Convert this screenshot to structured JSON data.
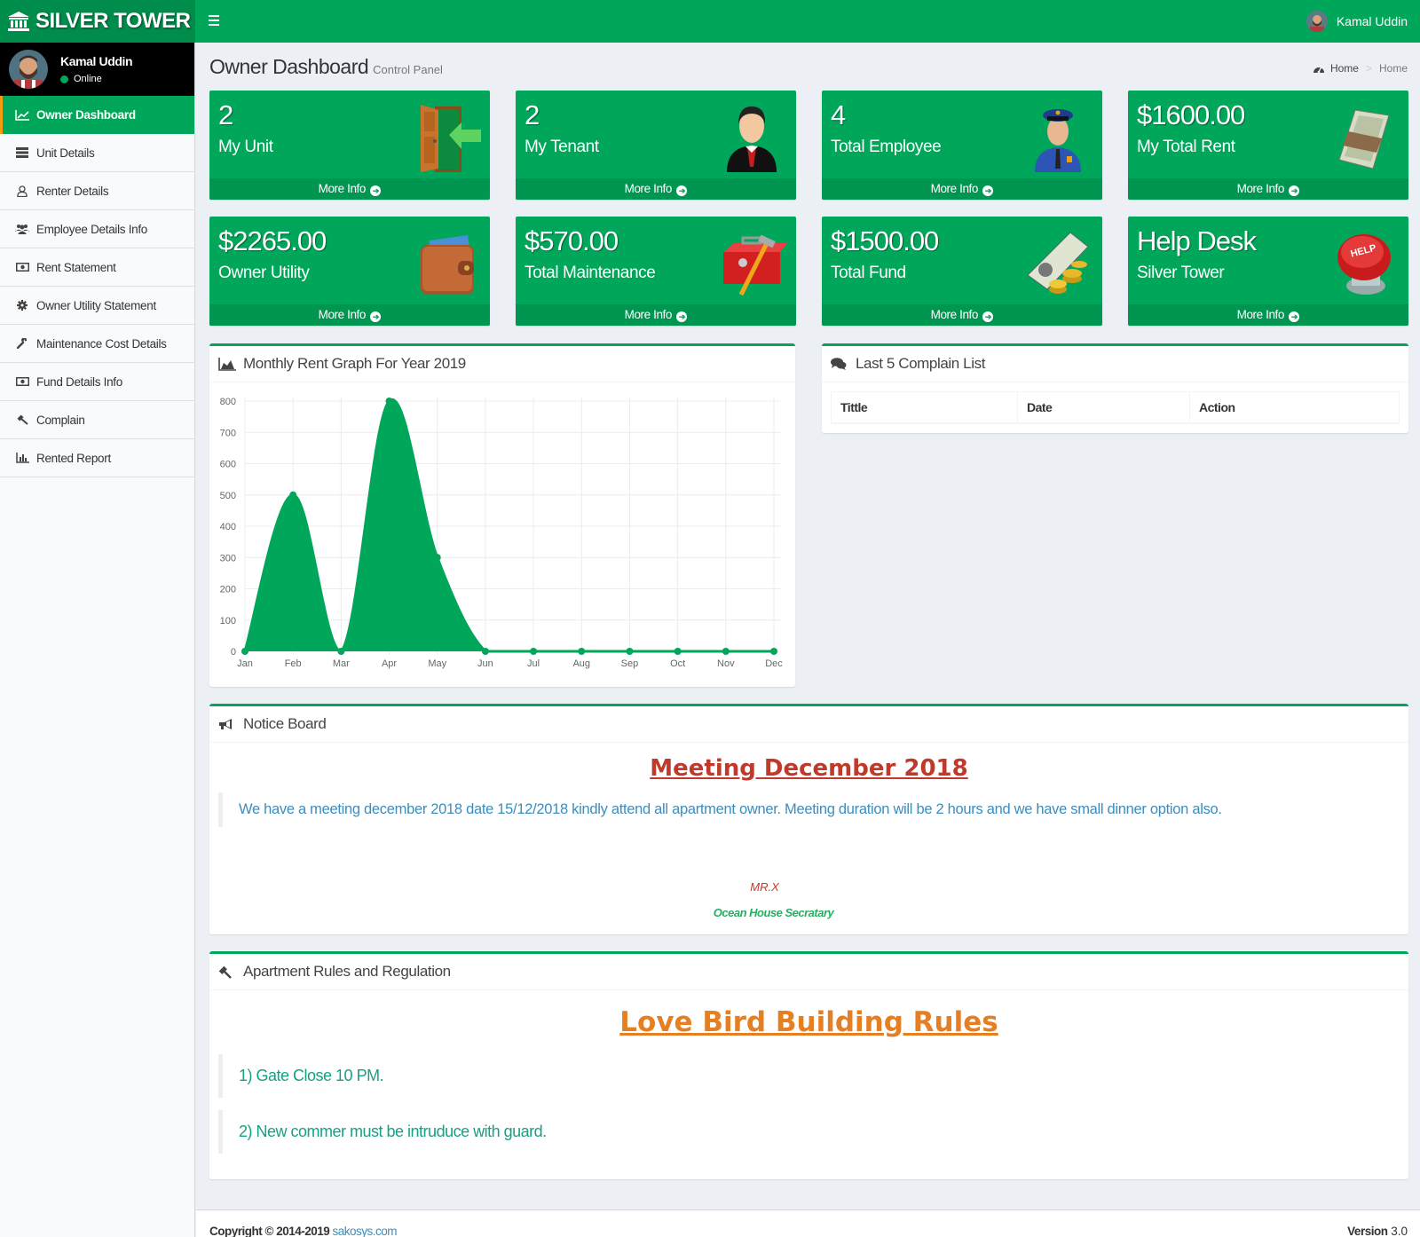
{
  "app": {
    "logo_text": "SILVER TOWER"
  },
  "topbar": {
    "user_name": "Kamal Uddin"
  },
  "user_panel": {
    "name": "Kamal Uddin",
    "status": "Online"
  },
  "sidebar": {
    "items": [
      {
        "label": "Owner Dashboard",
        "icon": "line-chart-icon",
        "active": true
      },
      {
        "label": "Unit Details",
        "icon": "list-icon"
      },
      {
        "label": "Renter Details",
        "icon": "user-icon"
      },
      {
        "label": "Employee Details Info",
        "icon": "users-icon"
      },
      {
        "label": "Rent Statement",
        "icon": "money-icon"
      },
      {
        "label": "Owner Utility Statement",
        "icon": "gear-icon"
      },
      {
        "label": "Maintenance Cost Details",
        "icon": "wrench-icon"
      },
      {
        "label": "Fund Details Info",
        "icon": "money-icon"
      },
      {
        "label": "Complain",
        "icon": "gavel-icon"
      },
      {
        "label": "Rented Report",
        "icon": "bar-chart-icon"
      }
    ]
  },
  "header": {
    "title": "Owner Dashboard",
    "subtitle": "Control Panel"
  },
  "breadcrumb": {
    "home": "Home",
    "current": "Home"
  },
  "stat_boxes": [
    {
      "value": "2",
      "label": "My Unit",
      "icon": "door-icon",
      "more": "More Info"
    },
    {
      "value": "2",
      "label": "My Tenant",
      "icon": "businessman-icon",
      "more": "More Info"
    },
    {
      "value": "4",
      "label": "Total Employee",
      "icon": "guard-icon",
      "more": "More Info"
    },
    {
      "value": "$1600.00",
      "label": "My Total Rent",
      "icon": "cash-stack-icon",
      "more": "More Info"
    },
    {
      "value": "$2265.00",
      "label": "Owner Utility",
      "icon": "wallet-icon",
      "more": "More Info"
    },
    {
      "value": "$570.00",
      "label": "Total Maintenance",
      "icon": "toolbox-icon",
      "more": "More Info"
    },
    {
      "value": "$1500.00",
      "label": "Total Fund",
      "icon": "cash-coins-icon",
      "more": "More Info"
    },
    {
      "value": "Help Desk",
      "label": "Silver Tower",
      "icon": "help-button-icon",
      "more": "More Info"
    }
  ],
  "rent_graph": {
    "title": "Monthly Rent Graph For Year 2019"
  },
  "chart_data": {
    "type": "area",
    "title": "Monthly Rent Graph For Year 2019",
    "categories": [
      "Jan",
      "Feb",
      "Mar",
      "Apr",
      "May",
      "Jun",
      "Jul",
      "Aug",
      "Sep",
      "Oct",
      "Nov",
      "Dec"
    ],
    "values": [
      0,
      500,
      0,
      800,
      300,
      0,
      0,
      0,
      0,
      0,
      0,
      0
    ],
    "yticks": [
      0,
      100,
      200,
      300,
      400,
      500,
      600,
      700,
      800
    ],
    "ylim": [
      0,
      800
    ],
    "xlabel": "",
    "ylabel": "",
    "grid": true,
    "color": "#00a65a"
  },
  "complain_list": {
    "title": "Last 5 Complain List",
    "columns": [
      "Tittle",
      "Date",
      "Action"
    ],
    "rows": []
  },
  "notice_board": {
    "title": "Notice Board",
    "heading": "Meeting December 2018",
    "body": "We have a meeting december 2018 date 15/12/2018 kindly attend all apartment owner. Meeting duration will be 2 hours and we have small dinner option also.",
    "signature_name": "MR.X",
    "signature_role": "Ocean House Secratary"
  },
  "rules": {
    "title": "Apartment Rules and Regulation",
    "heading": "Love Bird Building Rules",
    "items": [
      "1) Gate Close 10 PM.",
      "2) New commer must be intruduce with guard."
    ]
  },
  "footer": {
    "copyright": "Copyright © 2014-2019",
    "link": "sakosys.com",
    "version_label": "Version",
    "version": "3.0"
  }
}
